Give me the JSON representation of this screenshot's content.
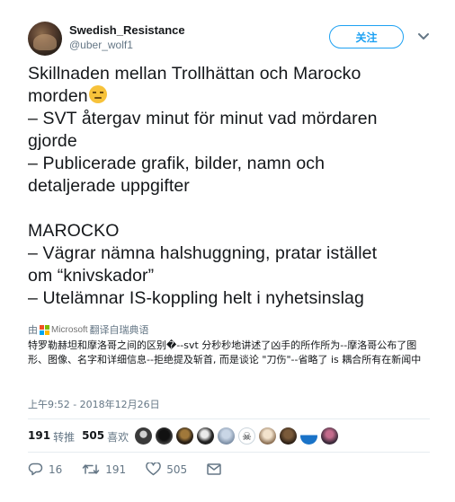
{
  "header": {
    "display_name": "Swedish_Resistance",
    "handle": "@uber_wolf1",
    "follow_label": "关注"
  },
  "tweet": {
    "lines": [
      "Skillnaden mellan Trollhättan och Marocko",
      "morden",
      "– SVT återgav minut för minut vad mördaren",
      "gjorde",
      "– Publicerade grafik, bilder, namn och",
      "detaljerade uppgifter",
      "MAROCKO",
      "– Vägrar nämna halshuggning, pratar istället",
      "om “knivskador”",
      "– Utelämnar IS-koppling helt i nyhetsinslag"
    ],
    "emoji": "unamused-face-emoji"
  },
  "translation": {
    "by_prefix": "由",
    "provider": "Microsoft",
    "by_suffix": "翻译自瑞典语",
    "text": "特罗勒赫坦和摩洛哥之间的区别�--svt 分秒秒地讲述了凶手的所作所为--摩洛哥公布了图形、图像、名字和详细信息--拒绝提及斩首, 而是谈论 \"刀伤\"--省略了 is 耦合所有在新闻中"
  },
  "timestamp": "上午9:52 - 2018年12月26日",
  "stats": {
    "retweets_count": "191",
    "retweets_label": "转推",
    "likes_count": "505",
    "likes_label": "喜欢"
  },
  "liker_avatars": [
    "avatar-1",
    "avatar-2",
    "avatar-3",
    "avatar-4",
    "avatar-5",
    "avatar-6",
    "avatar-7",
    "avatar-8",
    "avatar-9",
    "avatar-10"
  ],
  "actions": {
    "reply_count": "16",
    "retweet_count": "191",
    "like_count": "505"
  },
  "colors": {
    "accent": "#1da1f2",
    "text": "#14171a",
    "muted": "#657786",
    "retweet_green": "#17bf63"
  }
}
